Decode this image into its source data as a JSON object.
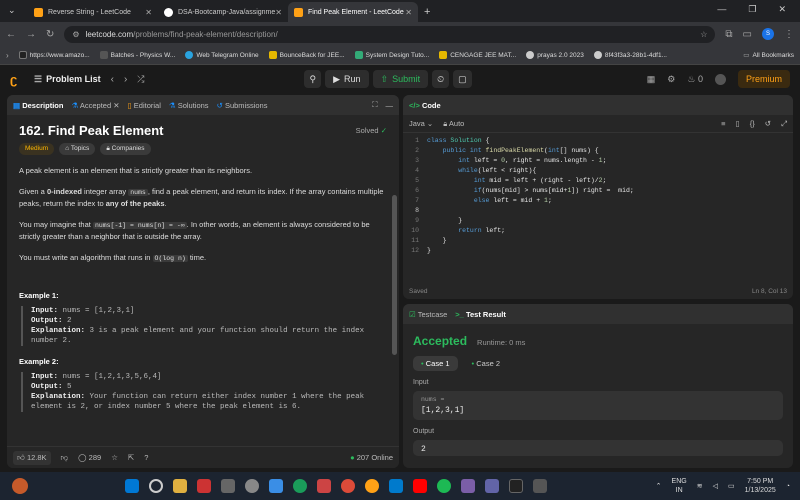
{
  "browser": {
    "tabs": [
      {
        "title": "Reverse String - LeetCode",
        "color": "#ffa116"
      },
      {
        "title": "DSA-Bootcamp-Java/assignme",
        "color": "#ffffff"
      },
      {
        "title": "Find Peak Element - LeetCode",
        "color": "#ffa116"
      }
    ],
    "url_host": "leetcode.com",
    "url_path": "/problems/find-peak-element/description/",
    "bookmarks": [
      "https://www.amazo...",
      "Batches - Physics W...",
      "Web Telegram Online",
      "BounceBack for JEE...",
      "System Design Tuto...",
      "CENGAGE JEE MAT...",
      "prayas 2.0 2023",
      "8f43f3a3-28b1-4df1..."
    ],
    "all_bookmarks": "All Bookmarks",
    "profile_letter": "S"
  },
  "lc_header": {
    "problem_list": "Problem List",
    "run": "Run",
    "submit": "Submit",
    "streak": "0",
    "premium": "Premium"
  },
  "left_tabs": {
    "description": "Description",
    "accepted": "Accepted",
    "editorial": "Editorial",
    "solutions": "Solutions",
    "submissions": "Submissions"
  },
  "problem": {
    "title": "162. Find Peak Element",
    "status": "Solved",
    "difficulty": "Medium",
    "topics": "Topics",
    "companies": "Companies",
    "p1": "A peak element is an element that is strictly greater than its neighbors.",
    "p2a": "Given a ",
    "p2b": "0-indexed",
    "p2c": " integer array ",
    "p2code": "nums",
    "p2d": ", find a peak element, and return its index. If the array contains multiple peaks, return the index to ",
    "p2e": "any of the peaks",
    "p2f": ".",
    "p3a": "You may imagine that ",
    "p3code": "nums[-1] = nums[n] = -∞",
    "p3b": ". In other words, an element is always considered to be strictly greater than a neighbor that is outside the array.",
    "p4a": "You must write an algorithm that runs in ",
    "p4code": "O(log n)",
    "p4b": " time.",
    "ex1_title": "Example 1:",
    "ex1_input": "nums = [1,2,3,1]",
    "ex1_output": "2",
    "ex1_expl": "3 is a peak element and your function should return the index number 2.",
    "ex2_title": "Example 2:",
    "ex2_input": "nums = [1,2,1,3,5,6,4]",
    "ex2_output": "5",
    "ex2_expl": "Your function can return either index number 1 where the peak element is 2, or index number 5 where the peak element is 6.",
    "lbl_input": "Input:",
    "lbl_output": "Output:",
    "lbl_expl": "Explanation:"
  },
  "footer": {
    "likes": "12.8K",
    "comments": "289",
    "online": "207 Online"
  },
  "editor": {
    "title": "Code",
    "lang": "Java",
    "auto": "Auto",
    "saved": "Saved",
    "cursor": "Ln 8, Col 13",
    "lines": [
      "class Solution {",
      "    public int findPeakElement(int[] nums) {",
      "        int left = 0, right = nums.length - 1;",
      "        while(left < right){",
      "            int mid = left + (right - left)/2;",
      "            if(nums[mid] > nums[mid+1]) right =  mid;",
      "            else left = mid + 1;",
      "",
      "        }",
      "        return left;",
      "    }",
      "}"
    ]
  },
  "result": {
    "testcase_tab": "Testcase",
    "result_tab": "Test Result",
    "status": "Accepted",
    "runtime": "Runtime: 0 ms",
    "case1": "Case 1",
    "case2": "Case 2",
    "input_label": "Input",
    "var_name": "nums =",
    "var_value": "[1,2,3,1]",
    "output_label": "Output",
    "output_value": "2"
  },
  "taskbar": {
    "lang": "ENG",
    "region": "IN",
    "time": "7:50 PM",
    "date": "1/13/2025"
  }
}
